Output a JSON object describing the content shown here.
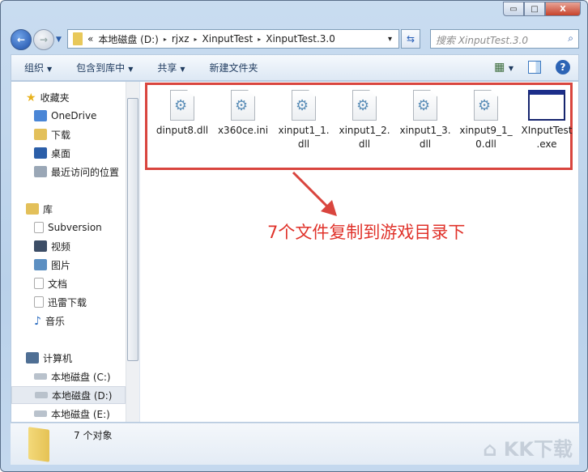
{
  "window": {
    "minimize": "▭",
    "maximize": "□",
    "close": "X"
  },
  "address": {
    "overflow": "«",
    "segments": [
      "本地磁盘 (D:)",
      "rjxz",
      "XinputTest",
      "XinputTest.3.0"
    ],
    "sep": "▸",
    "dropdown": "▾"
  },
  "search": {
    "placeholder": "搜索 XinputTest.3.0"
  },
  "toolbar": {
    "organize": "组织",
    "include_library": "包含到库中",
    "share": "共享",
    "new_folder": "新建文件夹",
    "help": "?"
  },
  "sidebar": {
    "favorites": "收藏夹",
    "onedrive": "OneDrive",
    "downloads": "下载",
    "desktop": "桌面",
    "recent": "最近访问的位置",
    "libraries": "库",
    "subversion": "Subversion",
    "videos": "视频",
    "pictures": "图片",
    "documents": "文档",
    "thunder": "迅雷下载",
    "music": "音乐",
    "computer": "计算机",
    "drive_c": "本地磁盘 (C:)",
    "drive_d": "本地磁盘 (D:)",
    "drive_e": "本地磁盘 (E:)"
  },
  "files": [
    {
      "l1": "dinput8.dll",
      "l2": ""
    },
    {
      "l1": "x360ce.ini",
      "l2": ""
    },
    {
      "l1": "xinput1_1.",
      "l2": "dll"
    },
    {
      "l1": "xinput1_2.",
      "l2": "dll"
    },
    {
      "l1": "xinput1_3.",
      "l2": "dll"
    },
    {
      "l1": "xinput9_1_",
      "l2": "0.dll"
    },
    {
      "l1": "XInputTest",
      "l2": ".exe"
    }
  ],
  "annotation": "7个文件复制到游戏目录下",
  "status": {
    "count": "7 个对象"
  },
  "watermark": "KK下载"
}
